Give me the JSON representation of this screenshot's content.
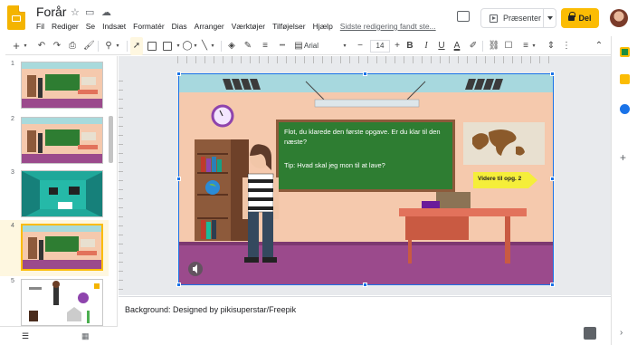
{
  "header": {
    "title": "Forår",
    "menu": [
      "Fil",
      "Rediger",
      "Se",
      "Indsæt",
      "Formatér",
      "Dias",
      "Arranger",
      "Værktøjer",
      "Tilføjelser",
      "Hjælp"
    ],
    "last_edit": "Sidste redigering fandt ste...",
    "present_label": "Præsenter",
    "share_label": "Del"
  },
  "toolbar": {
    "font": "Arial",
    "font_size": "14"
  },
  "filmstrip": {
    "slide_numbers": [
      "1",
      "2",
      "3",
      "4",
      "5"
    ],
    "selected": "4"
  },
  "slide": {
    "board_text_1": "Flot, du klarede den første opgave. Er du klar til den næste?",
    "board_text_2": "Tip: Hvad skal jeg mon til at lave?",
    "next_button": "Videre til opg. 2"
  },
  "notes": {
    "text": "Background: Designed by pikisuperstar/Freepik"
  },
  "colors": {
    "accent": "#fbbc04",
    "selection": "#1a73e8",
    "board": "#2e7d32"
  }
}
